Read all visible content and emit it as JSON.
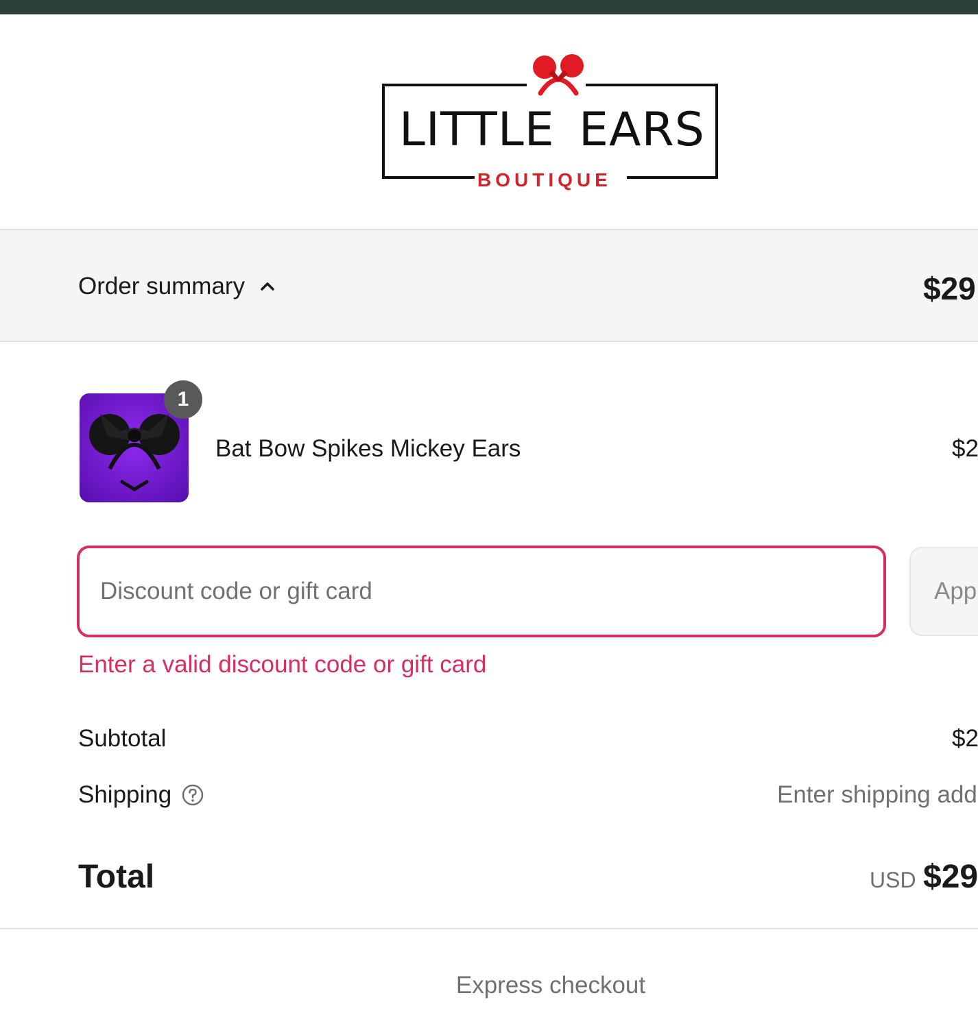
{
  "brand": {
    "logo_text_left": "LITTLE",
    "logo_text_right": "EARS",
    "logo_subtext": "BOUTIQUE",
    "accent_color": "#d2232a"
  },
  "colors": {
    "top_bar": "#2c403b",
    "error": "#d72d63",
    "summary_background": "#f5f5f5"
  },
  "order_summary": {
    "toggle_label": "Order summary",
    "toggle_icon": "chevron-up-icon",
    "total_display": "$29"
  },
  "product": {
    "name": "Bat Bow Spikes Mickey Ears",
    "quantity": "1",
    "price": "$2"
  },
  "discount": {
    "placeholder": "Discount code or gift card",
    "value": "",
    "apply_label": "App",
    "error_message": "Enter a valid discount code or gift card"
  },
  "totals": {
    "subtotal_label": "Subtotal",
    "subtotal_value": "$2",
    "shipping_label": "Shipping",
    "shipping_help_icon": "question-circle-icon",
    "shipping_value": "Enter shipping add",
    "total_label": "Total",
    "currency": "USD",
    "total_value": "$29"
  },
  "express_checkout": {
    "label": "Express checkout"
  }
}
